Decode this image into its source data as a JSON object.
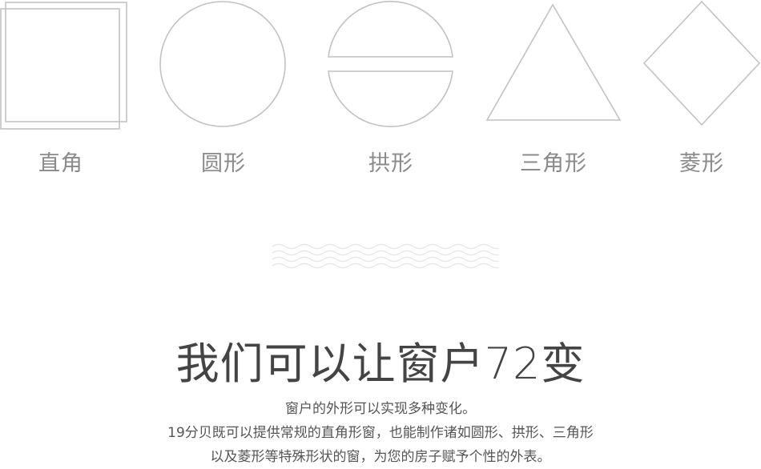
{
  "shapes": [
    {
      "icon": "square-outline-icon",
      "label": "直角"
    },
    {
      "icon": "circle-outline-icon",
      "label": "圆形"
    },
    {
      "icon": "arch-outline-icon",
      "label": "拱形"
    },
    {
      "icon": "triangle-outline-icon",
      "label": "三角形"
    },
    {
      "icon": "diamond-outline-icon",
      "label": "菱形"
    }
  ],
  "divider_icon": "wave-pattern-icon",
  "headline": "我们可以让窗户72变",
  "description": {
    "line1": "窗户的外形可以实现多种变化。",
    "line2": "19分贝既可以提供常规的直角形窗，也能制作诸如圆形、拱形、三角形",
    "line3": "以及菱形等特殊形状的窗，为您的房子赋予个性的外表。"
  },
  "colors": {
    "outline": "#bdbdbd",
    "label": "#8a8a8a",
    "headline": "#444444",
    "body_text": "#555555",
    "wave": "#e3e3e3"
  }
}
